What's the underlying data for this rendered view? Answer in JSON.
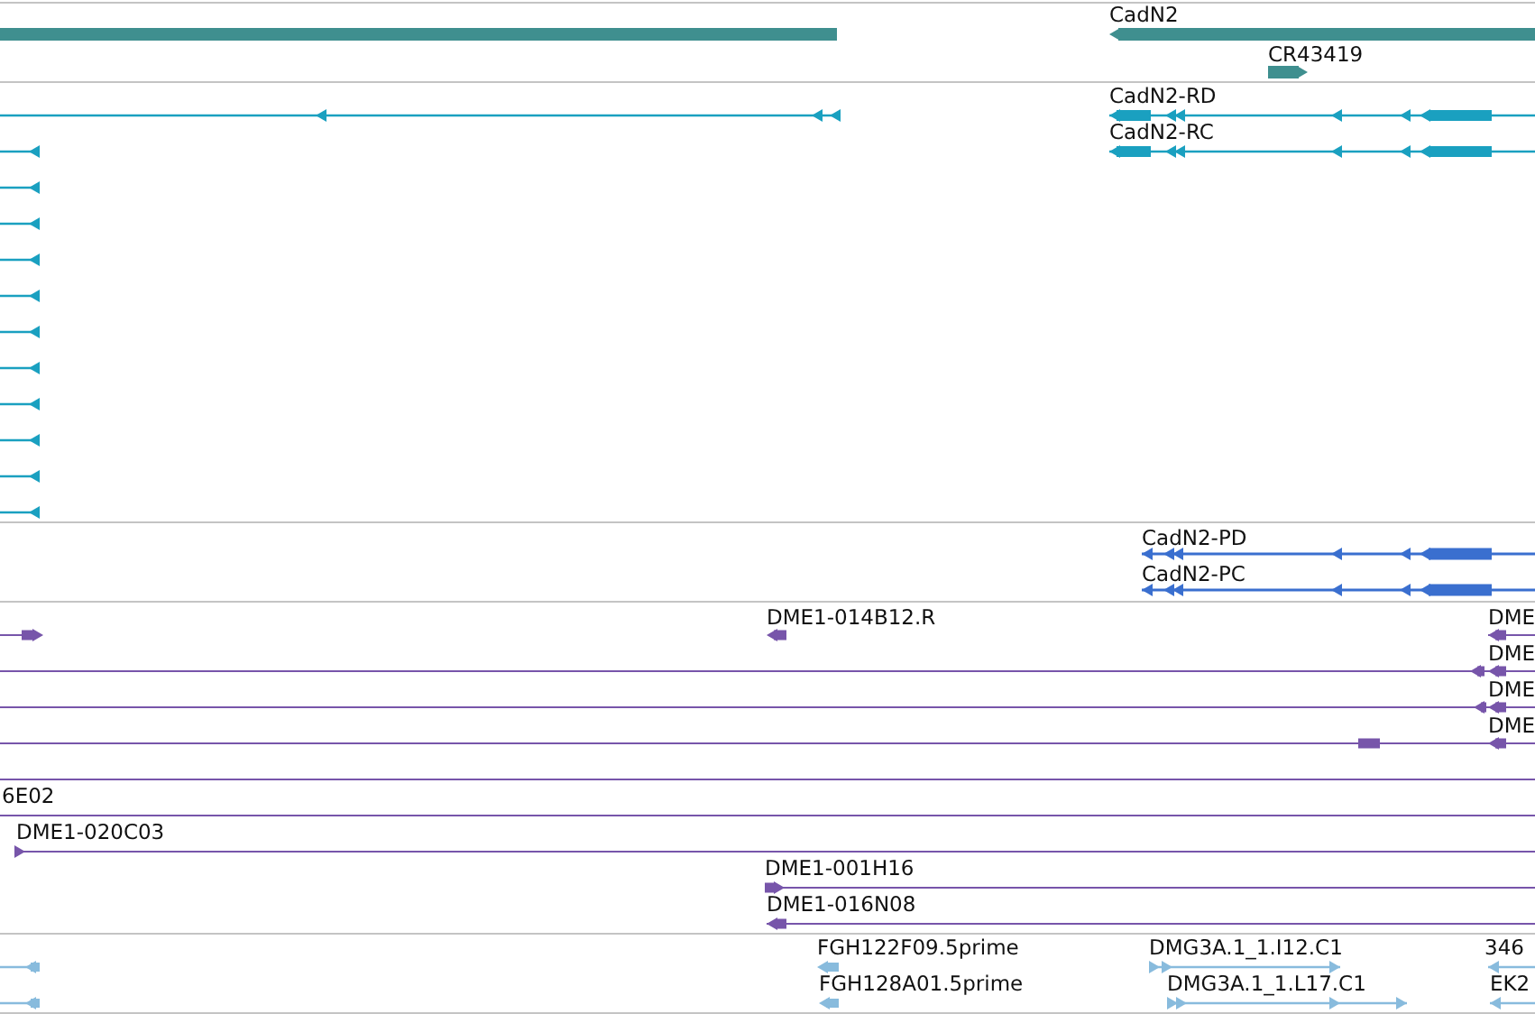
{
  "tracks": [
    {
      "kind": "gene",
      "color": "#3f8f8f",
      "features": [
        {
          "label": "CadN2"
        },
        {
          "label": "CR43419"
        }
      ]
    },
    {
      "kind": "transcript",
      "color": "#1aa0c0",
      "features": [
        {
          "label": "CadN2-RD"
        },
        {
          "label": "CadN2-RC"
        }
      ]
    },
    {
      "kind": "protein",
      "color": "#3a6fcf",
      "features": [
        {
          "label": "CadN2-PD"
        },
        {
          "label": "CadN2-PC"
        }
      ]
    },
    {
      "kind": "clone",
      "color": "#7755aa",
      "features": [
        {
          "label": "DME1-014B12.R"
        },
        {
          "label": "DME"
        },
        {
          "label": "DME"
        },
        {
          "label": "DME"
        },
        {
          "label": "DME"
        },
        {
          "label": "6E02"
        },
        {
          "label": "DME1-020C03"
        },
        {
          "label": "DME1-001H16"
        },
        {
          "label": "DME1-016N08"
        }
      ]
    },
    {
      "kind": "est",
      "color": "#88bbdd",
      "features": [
        {
          "label": "FGH122F09.5prime"
        },
        {
          "label": "DMG3A.1_1.I12.C1"
        },
        {
          "label": "346"
        },
        {
          "label": "FGH128A01.5prime"
        },
        {
          "label": "DMG3A.1_1.L17.C1"
        },
        {
          "label": "EK2"
        }
      ]
    }
  ]
}
